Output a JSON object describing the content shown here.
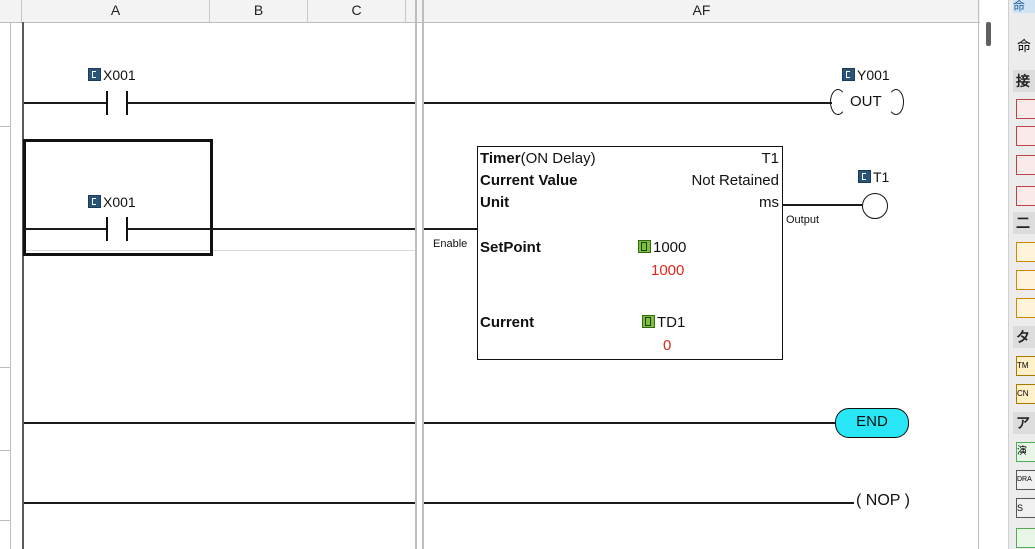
{
  "columns": {
    "a": "A",
    "b": "B",
    "c": "C",
    "af": "AF"
  },
  "rung1": {
    "contact_label": "X001",
    "coil_label": "Y001",
    "coil_text": "OUT"
  },
  "rung2": {
    "contact_label": "X001",
    "enable_label": "Enable",
    "output_label": "Output",
    "coil_label": "T1",
    "timer": {
      "title_bold": "Timer",
      "title_rest": "(ON Delay)",
      "id": "T1",
      "current_value_label": "Current Value",
      "current_value": "Not Retained",
      "unit_label": "Unit",
      "unit_value": "ms",
      "setpoint_label": "SetPoint",
      "setpoint_ref": "1000",
      "setpoint_value": "1000",
      "current_label": "Current",
      "current_ref": "TD1",
      "current_value_num": "0"
    }
  },
  "end_label": "END",
  "nop_label": "( NOP )",
  "right_panel": {
    "top_glyph": "命",
    "second_glyph": "命",
    "section_glyphs": [
      "接",
      "二",
      "タ",
      "ア"
    ],
    "item_glyphs": [
      "TM",
      "CN",
      "演",
      "DRA",
      "S"
    ]
  },
  "colors": {
    "end_fill": "#28e6f5",
    "value_red": "#e0281c",
    "device_icon_blue": "#2a5378",
    "device_icon_green": "#7fbf3b"
  }
}
